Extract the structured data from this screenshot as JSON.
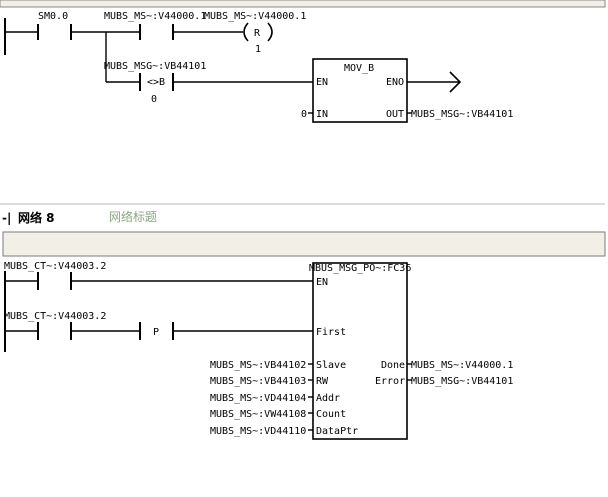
{
  "network_top": {
    "contact_sm0": "SM0.0",
    "contact_r_addr": "MUBS_MS~:V44000.1",
    "coil_r_addr": "MUBS_MS~:V44000.1",
    "coil_r_type": "R",
    "coil_r_count": "1",
    "compare_addr": "MUBS_MSG~:VB44101",
    "compare_op": "<>B",
    "compare_value": "0",
    "movb": {
      "title": "MOV_B",
      "en": "EN",
      "eno": "ENO",
      "in_label": "IN",
      "in_value": "0",
      "out_label": "OUT",
      "out_value": "MUBS_MSG~:VB44101"
    }
  },
  "network8": {
    "header_label": "网络 8",
    "title": "网络标题",
    "contact1_addr": "MUBS_CT~:V44003.2",
    "contact2_addr": "MUBS_CT~:V44003.2",
    "contact2_p": "P",
    "block": {
      "title": "MBUS_MSG_PO~:FC36",
      "en": "EN",
      "first": "First",
      "inputs": [
        {
          "label": "Slave",
          "value": "MUBS_MS~:VB44102"
        },
        {
          "label": "RW",
          "value": "MUBS_MS~:VB44103"
        },
        {
          "label": "Addr",
          "value": "MUBS_MS~:VD44104"
        },
        {
          "label": "Count",
          "value": "MUBS_MS~:VW44108"
        },
        {
          "label": "DataPtr",
          "value": "MUBS_MS~:VD44110"
        }
      ],
      "outputs": [
        {
          "label": "Done",
          "value": "MUBS_MS~:V44000.1"
        },
        {
          "label": "Error",
          "value": "MUBS_MSG~:VB44101"
        }
      ]
    }
  },
  "colors": {
    "header_bar": "#f2f0e6",
    "title": "#8aa880",
    "wire": "#000000"
  }
}
